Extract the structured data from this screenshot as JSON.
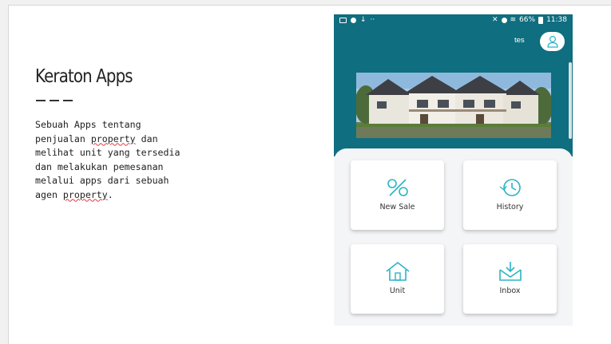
{
  "slide": {
    "title": "Keraton Apps",
    "description_lines": [
      "Sebuah Apps tentang",
      "penjualan ",
      "property",
      " dan",
      "melihat unit yang tersedia",
      "dan melakukan pemesanan",
      "melalui apps dari sebuah",
      "agen ",
      "property",
      "."
    ]
  },
  "phone": {
    "status_bar": {
      "battery": "66%",
      "time": "11:38"
    },
    "username": "tes",
    "menu": [
      {
        "label": "New Sale",
        "icon": "percent-icon"
      },
      {
        "label": "History",
        "icon": "history-icon"
      },
      {
        "label": "Unit",
        "icon": "house-icon"
      },
      {
        "label": "Inbox",
        "icon": "inbox-icon"
      }
    ],
    "colors": {
      "header": "#0f6e7f",
      "icon_accent": "#2bb4c6"
    }
  }
}
